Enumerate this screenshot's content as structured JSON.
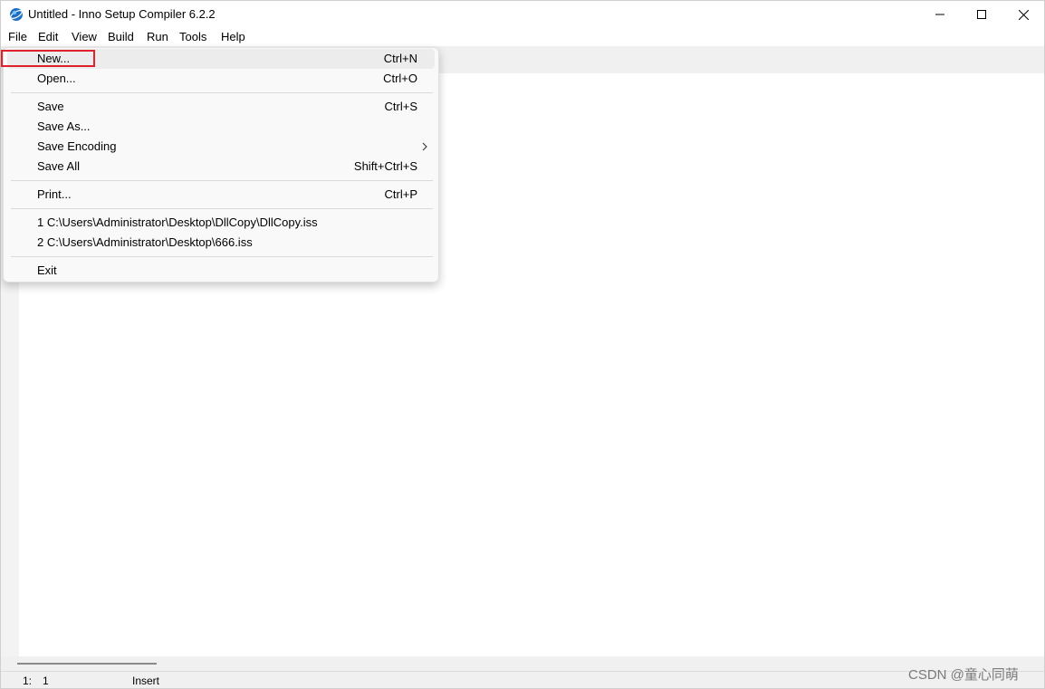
{
  "window": {
    "title": "Untitled - Inno Setup Compiler 6.2.2",
    "icon": "inno-setup-globe-icon"
  },
  "menubar": {
    "items": [
      {
        "label": "File"
      },
      {
        "label": "Edit"
      },
      {
        "label": "View"
      },
      {
        "label": "Build"
      },
      {
        "label": "Run"
      },
      {
        "label": "Tools"
      },
      {
        "label": "Help"
      }
    ]
  },
  "file_menu": {
    "items": [
      {
        "label": "New...",
        "shortcut": "Ctrl+N"
      },
      {
        "label": "Open...",
        "shortcut": "Ctrl+O"
      },
      {
        "label": "Save",
        "shortcut": "Ctrl+S"
      },
      {
        "label": "Save As...",
        "shortcut": ""
      },
      {
        "label": "Save Encoding",
        "shortcut": ""
      },
      {
        "label": "Save All",
        "shortcut": "Shift+Ctrl+S"
      },
      {
        "label": "Print...",
        "shortcut": "Ctrl+P"
      },
      {
        "label": "1 C:\\Users\\Administrator\\Desktop\\DllCopy\\DllCopy.iss",
        "shortcut": ""
      },
      {
        "label": "2 C:\\Users\\Administrator\\Desktop\\666.iss",
        "shortcut": ""
      },
      {
        "label": "Exit",
        "shortcut": ""
      }
    ]
  },
  "statusbar": {
    "line": "1:",
    "column": "1",
    "mode": "Insert"
  },
  "watermark": "CSDN @童心同萌",
  "colors": {
    "highlight_border": "#e0202a",
    "menu_background": "#f9f9f9",
    "hover_background": "#ececec"
  }
}
